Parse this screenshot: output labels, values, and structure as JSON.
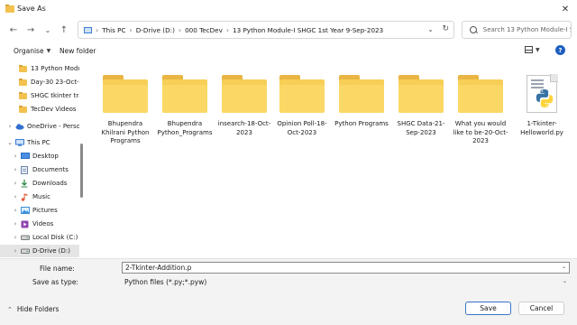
{
  "window": {
    "title": "Save As",
    "close_glyph": "✕"
  },
  "nav": {
    "back_glyph": "←",
    "forward_glyph": "→",
    "recent_glyph": "⌄",
    "up_glyph": "↑"
  },
  "address": {
    "crumbs": [
      "This PC",
      "D-Drive (D:)",
      "000 TecDev",
      "13 Python Module-I SHGC 1st Year 9-Sep-2023"
    ],
    "separator": "›",
    "chevron": "⌄",
    "refresh_glyph": "↻"
  },
  "search": {
    "placeholder": "Search 13 Python Module-I S..."
  },
  "toolbar": {
    "organise_label": "Organise",
    "new_folder_label": "New folder",
    "help_glyph": "?"
  },
  "sidebar": {
    "items": [
      {
        "label": "13 Python Modu",
        "type": "folder"
      },
      {
        "label": "Day-30 23-Oct-2",
        "type": "folder"
      },
      {
        "label": "SHGC tkinter tra",
        "type": "folder"
      },
      {
        "label": "TecDev Videos",
        "type": "folder"
      },
      {
        "label": "OneDrive - Person",
        "type": "cloud"
      },
      {
        "label": "This PC",
        "type": "pc"
      },
      {
        "label": "Desktop",
        "type": "desktop"
      },
      {
        "label": "Documents",
        "type": "documents"
      },
      {
        "label": "Downloads",
        "type": "downloads"
      },
      {
        "label": "Music",
        "type": "music"
      },
      {
        "label": "Pictures",
        "type": "pictures"
      },
      {
        "label": "Videos",
        "type": "videos"
      },
      {
        "label": "Local Disk (C:)",
        "type": "disk"
      },
      {
        "label": "D-Drive (D:)",
        "type": "disk"
      }
    ]
  },
  "files": [
    {
      "name": "Bhupendra Khilrani Python Programs",
      "type": "folder"
    },
    {
      "name": "Bhupendra Python_Programs",
      "type": "folder"
    },
    {
      "name": "insearch-18-Oct-2023",
      "type": "folder"
    },
    {
      "name": "Opinion Poll-18-Oct-2023",
      "type": "folder"
    },
    {
      "name": "Python Programs",
      "type": "folder"
    },
    {
      "name": "SHGC Data-21-Sep-2023",
      "type": "folder"
    },
    {
      "name": "What you would like to be-20-Oct-2023",
      "type": "folder"
    },
    {
      "name": "1-Tkinter-Helloworld.py",
      "type": "python"
    }
  ],
  "form": {
    "filename_label": "File name:",
    "filename_value": "2-Tkinter-Addition.p",
    "savetype_label": "Save as type:",
    "savetype_value": "Python files (*.py;*.pyw)"
  },
  "footer": {
    "hide_folders_label": "Hide Folders",
    "save_label": "Save",
    "cancel_label": "Cancel"
  },
  "colors": {
    "folder_yellow": "#f7cf57",
    "accent_blue": "#3b73c8",
    "selected_bg": "#e5e5e5"
  }
}
